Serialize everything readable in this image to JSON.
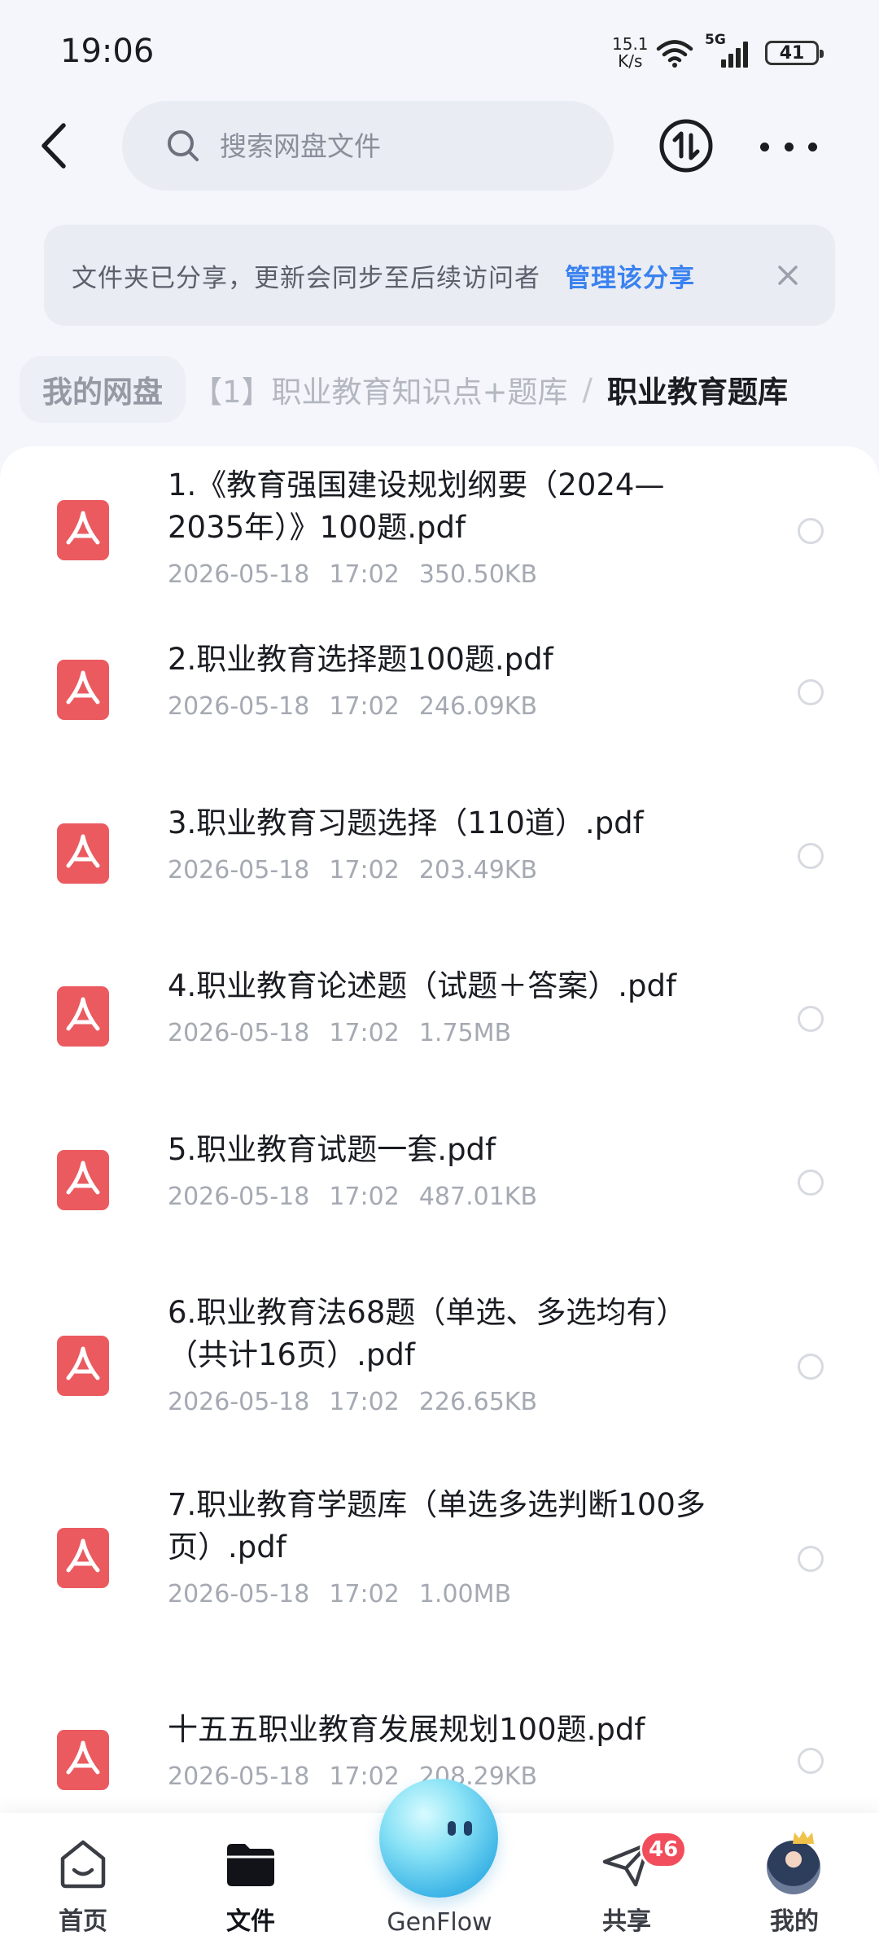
{
  "status_bar": {
    "time": "19:06",
    "net_speed_value": "15.1",
    "net_speed_unit": "K/s",
    "network_type": "5G",
    "battery_level": "41"
  },
  "search": {
    "placeholder": "搜索网盘文件"
  },
  "banner": {
    "text": "文件夹已分享，更新会同步至后续访问者",
    "link": "管理该分享"
  },
  "breadcrumb": {
    "home": "我的网盘",
    "middle": "【1】职业教育知识点+题库",
    "separator": "/",
    "current": "职业教育题库"
  },
  "files": [
    {
      "name": "1.《教育强国建设规划纲要（2024—2035年）》100题.pdf",
      "date": "2026-05-18",
      "time": "17:02",
      "size": "350.50KB"
    },
    {
      "name": "2.职业教育选择题100题.pdf",
      "date": "2026-05-18",
      "time": "17:02",
      "size": "246.09KB"
    },
    {
      "name": "3.职业教育习题选择（110道）.pdf",
      "date": "2026-05-18",
      "time": "17:02",
      "size": "203.49KB"
    },
    {
      "name": "4.职业教育论述题（试题＋答案）.pdf",
      "date": "2026-05-18",
      "time": "17:02",
      "size": "1.75MB"
    },
    {
      "name": "5.职业教育试题一套.pdf",
      "date": "2026-05-18",
      "time": "17:02",
      "size": "487.01KB"
    },
    {
      "name": "6.职业教育法68题（单选、多选均有）（共计16页）.pdf",
      "date": "2026-05-18",
      "time": "17:02",
      "size": "226.65KB"
    },
    {
      "name": "7.职业教育学题库（单选多选判断100多页）.pdf",
      "date": "2026-05-18",
      "time": "17:02",
      "size": "1.00MB"
    },
    {
      "name": "十五五职业教育发展规划100题.pdf",
      "date": "2026-05-18",
      "time": "17:02",
      "size": "208.29KB"
    }
  ],
  "bottom_nav": {
    "home": "首页",
    "files": "文件",
    "genflow": "GenFlow",
    "share": "共享",
    "share_badge": "46",
    "mine": "我的"
  },
  "colors": {
    "accent": "#3a82f0",
    "pdf_icon": "#ea5a5f",
    "badge": "#f24d5c"
  }
}
